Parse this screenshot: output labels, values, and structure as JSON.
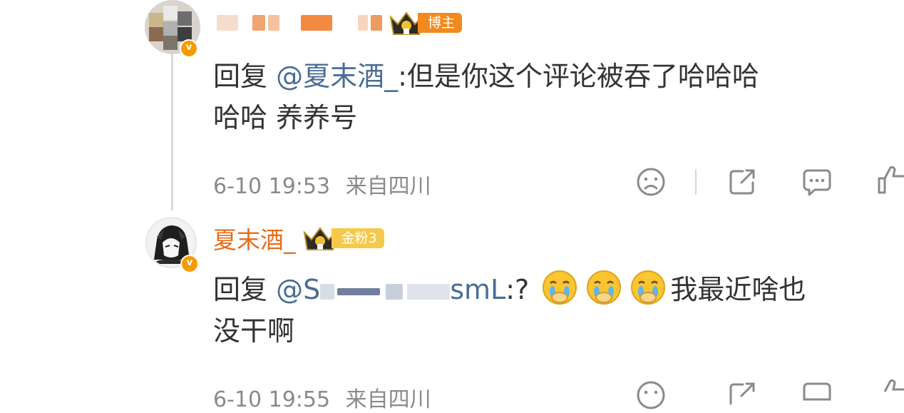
{
  "comment1": {
    "username": "",
    "badge_label": "博主",
    "reply_prefix": "回复",
    "mention": "@夏末酒_",
    "text_line1": ":但是你这个评论被吞了哈哈哈",
    "text_line2": "哈哈 养养号",
    "time": "6-10 19:53",
    "location": "来自四川"
  },
  "comment2": {
    "username": "夏末酒_",
    "badge_label": "金粉3",
    "reply_prefix": "回复",
    "mention": "@S",
    "mention_tail": "smL",
    "text_part1": ":?",
    "text_part2": "我最近啥也",
    "text_line2": "没干啊",
    "time": "6-10 19:55",
    "location": "来自四川"
  },
  "colors": {
    "username": "#e86b17",
    "mention": "#4a6d94",
    "badge_host": "#f18a1c",
    "badge_fan": "#f6c94a",
    "meta": "#8a8a8a"
  },
  "icons": [
    "frown-face-icon",
    "share-icon",
    "comment-icon",
    "like-icon",
    "verified-v-icon",
    "crown-icon",
    "crying-emoji-icon"
  ]
}
